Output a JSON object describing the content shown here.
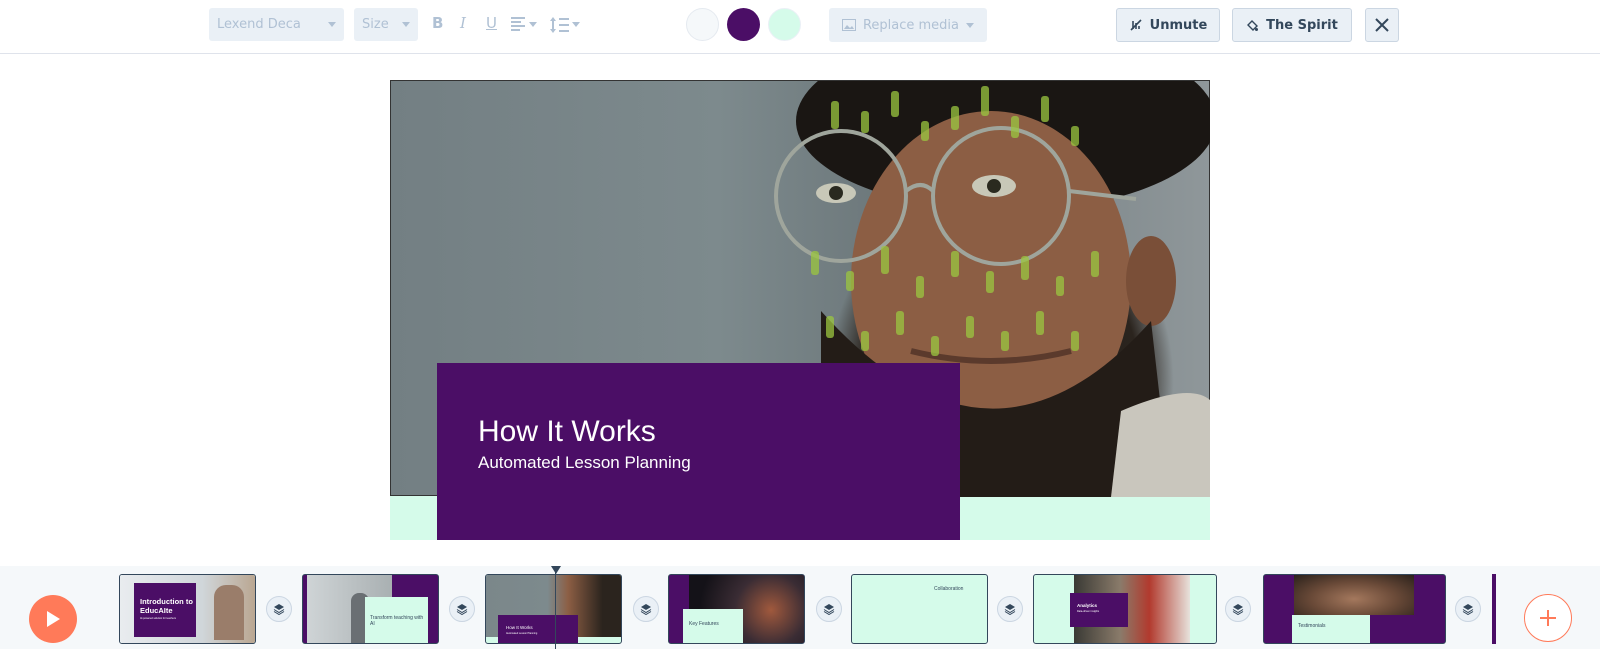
{
  "toolbar": {
    "font_family": "Lexend Deca",
    "size_label": "Size",
    "bold": "B",
    "italic": "I",
    "underline": "U",
    "colors": [
      "#f5f8fa",
      "#4b0e66",
      "#d5fbea"
    ],
    "replace_media_label": "Replace media",
    "unmute_label": "Unmute",
    "theme_label": "The Spirit"
  },
  "slide": {
    "title": "How It Works",
    "subtitle": "Automated Lesson Planning",
    "accent": "#4b0e66",
    "background": "#d5fbea"
  },
  "timeline": {
    "thumbnails": [
      {
        "title": "Introduction to EducAIte",
        "subtitle": "AI-powered solution for teachers"
      },
      {
        "title": "Transform teaching with AI"
      },
      {
        "title": "How It Works",
        "subtitle": "Automated Lesson Planning"
      },
      {
        "title": "Key Features"
      },
      {
        "title": "Collaboration"
      },
      {
        "title": "Analytics",
        "subtitle": "Data-driven insights"
      },
      {
        "title": "Testimonials"
      }
    ]
  }
}
